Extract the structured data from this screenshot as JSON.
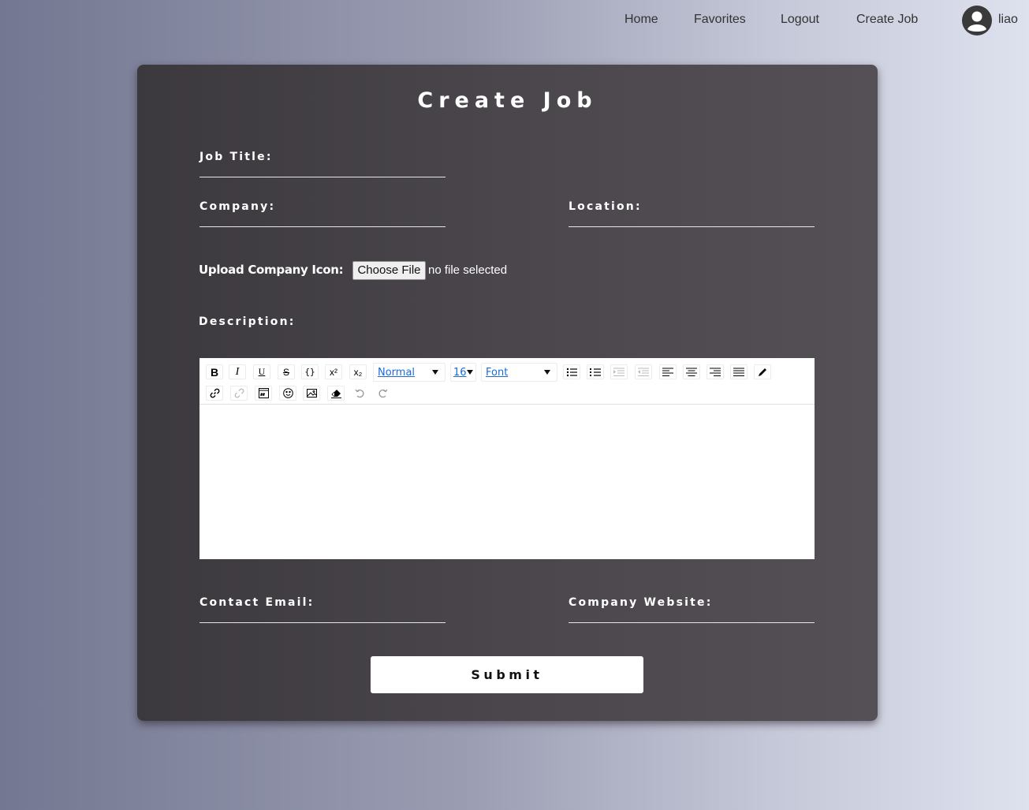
{
  "nav": {
    "links": [
      "Home",
      "Favorites",
      "Logout",
      "Create Job"
    ],
    "username": "liao"
  },
  "form": {
    "title": "Create Job",
    "job_title_label": "Job Title:",
    "company_label": "Company:",
    "location_label": "Location:",
    "upload_label": "Upload Company Icon:",
    "choose_file": "Choose File",
    "no_file": "no file selected",
    "description_label": "Description:",
    "contact_email_label": "Contact Email:",
    "company_website_label": "Company Website:",
    "submit": "Submit"
  },
  "editor": {
    "header_select": "Normal",
    "size_select": "16",
    "font_select": "Font"
  },
  "colors": {
    "card": "#4a464c",
    "link_blue": "#1d6ad8"
  }
}
